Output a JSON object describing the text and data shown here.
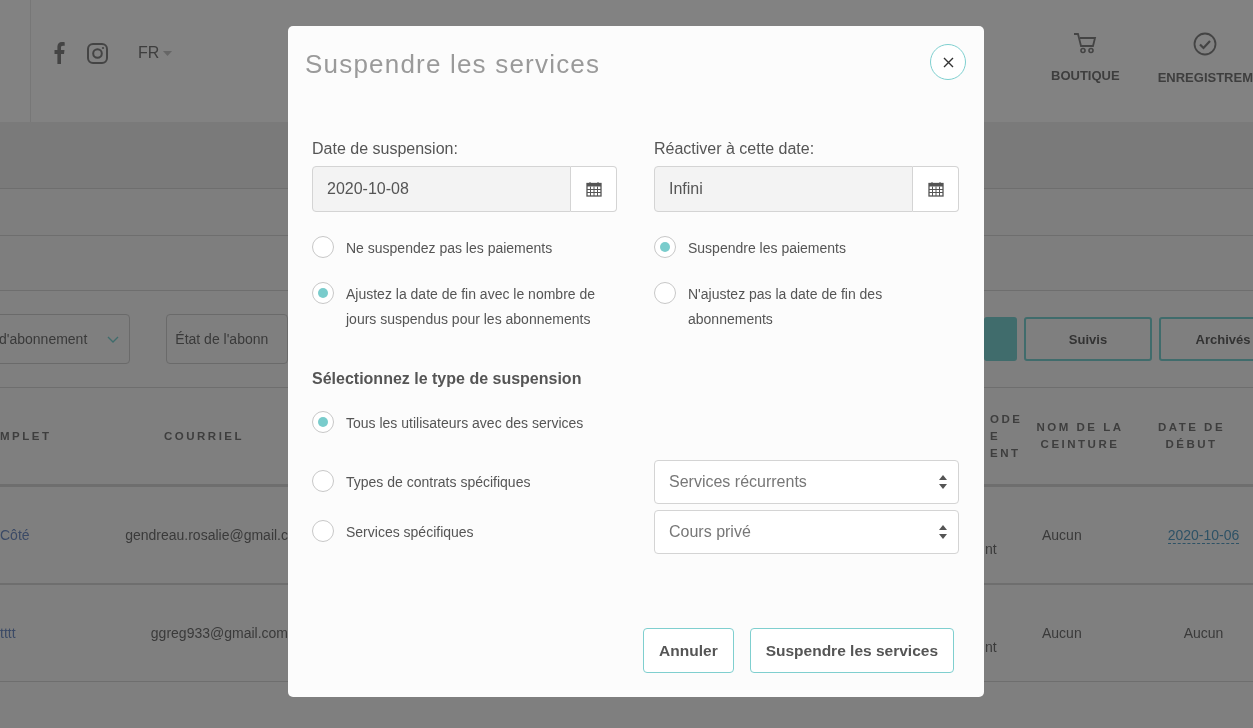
{
  "header": {
    "language": "FR",
    "nav": [
      {
        "label": "BOUTIQUE"
      },
      {
        "label": "ENREGISTREM"
      }
    ]
  },
  "filters": {
    "selects": [
      {
        "label": "d'abonnement",
        "chevron": true
      },
      {
        "label": "État de l'abonn",
        "chevron": false
      }
    ],
    "tabs": [
      {
        "selected": true
      },
      {
        "label": "Suivis",
        "selected": false
      },
      {
        "label": "Archivés",
        "selected": false
      }
    ]
  },
  "table": {
    "columns": [
      "MPLET",
      "COURRIEL",
      "ODE E ENT",
      "NOM DE LA CEINTURE",
      "DATE DE DÉBUT"
    ],
    "rows": [
      {
        "cells": [
          {
            "text": "Côté",
            "kind": "link"
          },
          {
            "text": "gendreau.rosalie@gmail.c",
            "kind": "text"
          },
          {
            "text": "nt",
            "kind": "text"
          },
          {
            "text": "Aucun",
            "kind": "text"
          },
          {
            "text": "2020-10-06",
            "kind": "dotted-link"
          }
        ]
      },
      {
        "cells": [
          {
            "text": "tttt",
            "kind": "link"
          },
          {
            "text": "ggreg933@gmail.com",
            "kind": "text"
          },
          {
            "text": "nt",
            "kind": "text"
          },
          {
            "text": "Aucun",
            "kind": "text"
          },
          {
            "text": "Aucun",
            "kind": "text"
          }
        ]
      }
    ]
  },
  "modal": {
    "title": "Suspendre les services",
    "date_fields": [
      {
        "label": "Date de suspension:",
        "value": "2020-10-08"
      },
      {
        "label": "Réactiver à cette date:",
        "value": "Infini"
      }
    ],
    "option_rows": [
      [
        {
          "label": "Ne suspendez pas les paiements",
          "selected": false
        },
        {
          "label": "Suspendre les paiements",
          "selected": true
        }
      ],
      [
        {
          "label": "Ajustez la date de fin avec le nombre de jours suspendus pour les abonnements",
          "selected": true
        },
        {
          "label": "N'ajustez pas la date de fin des abonnements",
          "selected": false
        }
      ]
    ],
    "suspension_type": {
      "heading": "Sélectionnez le type de suspension",
      "options": [
        {
          "label": "Tous les utilisateurs avec des services",
          "selected": true
        },
        {
          "label": "Types de contrats spécifiques",
          "selected": false,
          "select": "Services récurrents"
        },
        {
          "label": "Services spécifiques",
          "selected": false,
          "select": "Cours privé"
        }
      ]
    },
    "buttons": [
      "Annuler",
      "Suspendre les services"
    ]
  }
}
